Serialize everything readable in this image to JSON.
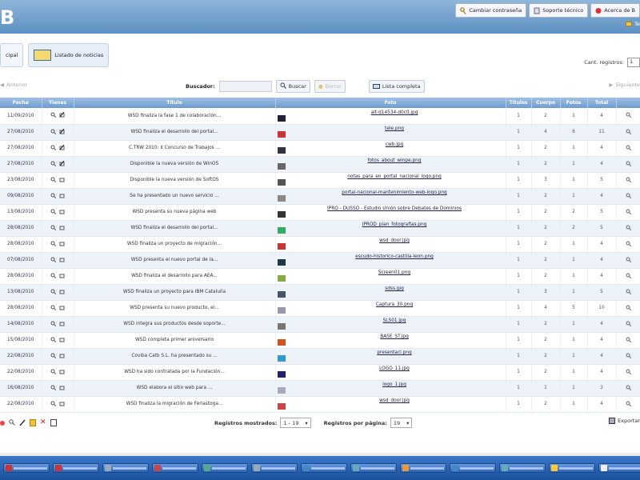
{
  "header": {
    "logo_text": "B",
    "links": [
      {
        "label": "Cambiar contraseña",
        "icon": "key-icon"
      },
      {
        "label": "Soporte técnico",
        "icon": "support-icon"
      },
      {
        "label": "Acerca de B",
        "icon": "info-icon"
      }
    ],
    "user_link": "Te"
  },
  "tabs": [
    {
      "label": "cipal",
      "icon": "home-icon"
    },
    {
      "label": "Listado de noticias",
      "icon": "list-icon",
      "active": true
    }
  ],
  "per_page": {
    "label": "Cant. registros:",
    "value": "1"
  },
  "toolbar": {
    "prev_label": "Anterior",
    "next_label": "Siguiente",
    "search_label": "Buscador:",
    "search_placeholder": "",
    "search_button": "Buscar",
    "reset_button": "Borrar",
    "full_list_button": "Lista completa"
  },
  "grid": {
    "columns": [
      "Fecha",
      "Tienes",
      "Título",
      "Foto",
      "Títulos",
      "Cuerpo",
      "Fotos",
      "Total"
    ],
    "rows": [
      {
        "date": "11/09/2010",
        "title": "WSD finaliza la fase 1 de colaboración...",
        "file": "alt-d14534-d0c0.jpg",
        "n1": "1",
        "n2": "2",
        "n3": "1",
        "total": "4"
      },
      {
        "date": "27/08/2010",
        "title": "WSD finaliza el desarrollo del portal...",
        "file": "tele.png",
        "n1": "1",
        "n2": "4",
        "n3": "6",
        "total": "11"
      },
      {
        "date": "27/08/2010",
        "title": "C.TRW 2010: II Concurso de Trabajos ...",
        "file": "cwb.jpg",
        "n1": "1",
        "n2": "2",
        "n3": "1",
        "total": "4"
      },
      {
        "date": "27/08/2010",
        "title": "Disponible la nueva versión de WinOS",
        "file": "fotos_about_winpe.png",
        "n1": "1",
        "n2": "2",
        "n3": "1",
        "total": "4"
      },
      {
        "date": "23/08/2010",
        "title": "Disponible la nueva versión de SoftOS",
        "file": "notas_para_en_portal_nacional_logo.png",
        "n1": "1",
        "n2": "3",
        "n3": "1",
        "total": "5"
      },
      {
        "date": "09/08/2010",
        "title": "Se ha presentado un nuevo servicio ...",
        "file": "portal-nacional-mantenimiento-web-logo.png",
        "n1": "1",
        "n2": "2",
        "n3": "1",
        "total": "4"
      },
      {
        "date": "13/08/2010",
        "title": "WSD presenta su nueva página web",
        "file": "IPRO - DUSSO - Estudio Unión sobre Debates de Dominios",
        "n1": "1",
        "n2": "2",
        "n3": "2",
        "total": "5"
      },
      {
        "date": "28/08/2010",
        "title": "WSD finaliza el desarrollo del portal...",
        "file": "IPROD_plan_fotografias.png",
        "n1": "1",
        "n2": "2",
        "n3": "2",
        "total": "5"
      },
      {
        "date": "28/08/2010",
        "title": "WSD finaliza un proyecto de migración...",
        "file": "wsd_door.jpg",
        "n1": "1",
        "n2": "2",
        "n3": "1",
        "total": "4"
      },
      {
        "date": "07/08/2010",
        "title": "WSD presenta el nuevo portal de la...",
        "file": "escudo-historico-castilla-leon.png",
        "n1": "1",
        "n2": "2",
        "n3": "1",
        "total": "4"
      },
      {
        "date": "28/08/2010",
        "title": "WSD finaliza el desarrollo para AEA...",
        "file": "Screen01.png",
        "n1": "1",
        "n2": "2",
        "n3": "1",
        "total": "4"
      },
      {
        "date": "13/08/2010",
        "title": "WSD finaliza un proyecto para IBM Cataluña",
        "file": "sdss.jpg",
        "n1": "1",
        "n2": "3",
        "n3": "1",
        "total": "5"
      },
      {
        "date": "28/08/2010",
        "title": "WSD presenta su nuevo producto, el...",
        "file": "Captura_30.png",
        "n1": "1",
        "n2": "4",
        "n3": "5",
        "total": "10"
      },
      {
        "date": "14/08/2010",
        "title": "WSD integra sus productos desde soporte...",
        "file": "SLS01.jpg",
        "n1": "1",
        "n2": "2",
        "n3": "1",
        "total": "4"
      },
      {
        "date": "15/08/2010",
        "title": "WSD completa primer aniversario",
        "file": "BASE_ST.jpg",
        "n1": "1",
        "n2": "2",
        "n3": "1",
        "total": "4"
      },
      {
        "date": "22/08/2010",
        "title": "Coviba Catb S.L. ha presentado su ...",
        "file": "presentaci.png",
        "n1": "1",
        "n2": "2",
        "n3": "1",
        "total": "4"
      },
      {
        "date": "22/08/2010",
        "title": "WSD ha sido contratada por la Fundación...",
        "file": "LOGO_11.jpg",
        "n1": "1",
        "n2": "2",
        "n3": "1",
        "total": "4"
      },
      {
        "date": "16/08/2010",
        "title": "WSD elabora el sitio web para ...",
        "file": "logo_1.jpg",
        "n1": "1",
        "n2": "1",
        "n3": "1",
        "total": "3"
      },
      {
        "date": "22/08/2010",
        "title": "WSD finaliza la migración de Feriastoga...",
        "file": "wsd_door.jpg",
        "n1": "1",
        "n2": "2",
        "n3": "1",
        "total": "4"
      }
    ]
  },
  "footer": {
    "pages_label": "Registros mostrados:",
    "pages_value": "1 - 19",
    "rows_label": "Registros por página:",
    "rows_value": "19",
    "export_label": "Exportar"
  },
  "colors": {
    "header_top": "#8eb6d9",
    "header_bottom": "#5d90c3",
    "grid_header": "#7ea8d6",
    "taskbar": "#2a63b5"
  }
}
